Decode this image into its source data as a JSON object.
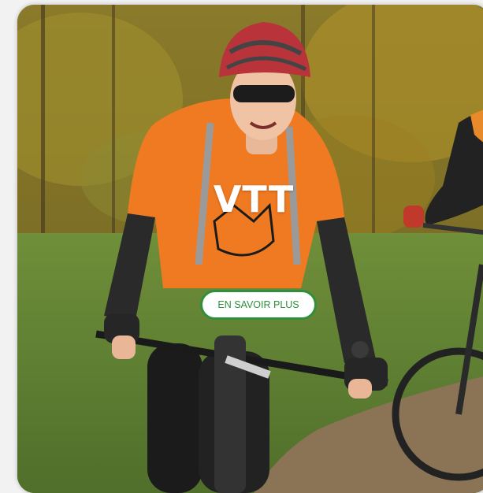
{
  "card": {
    "title": "VTT",
    "cta_label": "EN SAVOIR PLUS",
    "image": "mountain-bike-riders-photo"
  },
  "colors": {
    "accent": "#2f8f3a",
    "title_text": "#ffffff",
    "button_bg": "#ffffff"
  }
}
